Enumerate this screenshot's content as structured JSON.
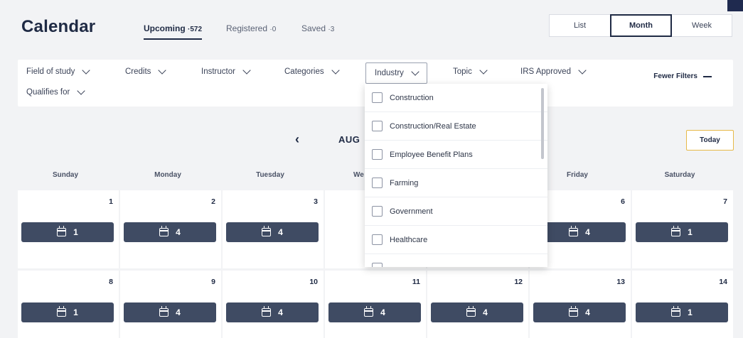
{
  "header": {
    "title": "Calendar",
    "tabs": [
      {
        "label": "Upcoming",
        "count": "572"
      },
      {
        "label": "Registered",
        "count": "0"
      },
      {
        "label": "Saved",
        "count": "3"
      }
    ],
    "views": [
      "List",
      "Month",
      "Week"
    ],
    "active_view": "Month"
  },
  "filters": {
    "items": [
      "Field of study",
      "Credits",
      "Instructor",
      "Categories",
      "Industry",
      "Topic",
      "IRS Approved",
      "Qualifies for"
    ],
    "fewer_label": "Fewer Filters"
  },
  "industry_dropdown": {
    "options": [
      "Construction",
      "Construction/Real Estate",
      "Employee Benefit Plans",
      "Farming",
      "Government",
      "Healthcare"
    ]
  },
  "nav": {
    "month_label": "AUG",
    "today_label": "Today"
  },
  "days": [
    "Sunday",
    "Monday",
    "Tuesday",
    "We",
    "",
    "Friday",
    "Saturday"
  ],
  "weeks": [
    [
      {
        "day": "1",
        "events": "1"
      },
      {
        "day": "2",
        "events": "4"
      },
      {
        "day": "3",
        "events": "4"
      },
      {
        "day": "",
        "events": ""
      },
      {
        "day": "",
        "events": ""
      },
      {
        "day": "6",
        "events": "4"
      },
      {
        "day": "7",
        "events": "1"
      }
    ],
    [
      {
        "day": "8",
        "events": "1"
      },
      {
        "day": "9",
        "events": "4"
      },
      {
        "day": "10",
        "events": "4"
      },
      {
        "day": "11",
        "events": "4"
      },
      {
        "day": "12",
        "events": "4"
      },
      {
        "day": "13",
        "events": "4"
      },
      {
        "day": "14",
        "events": "1"
      }
    ]
  ],
  "colors": {
    "accent": "#1f2a44",
    "chip": "#3f4b63",
    "today_border": "#e6b949"
  }
}
